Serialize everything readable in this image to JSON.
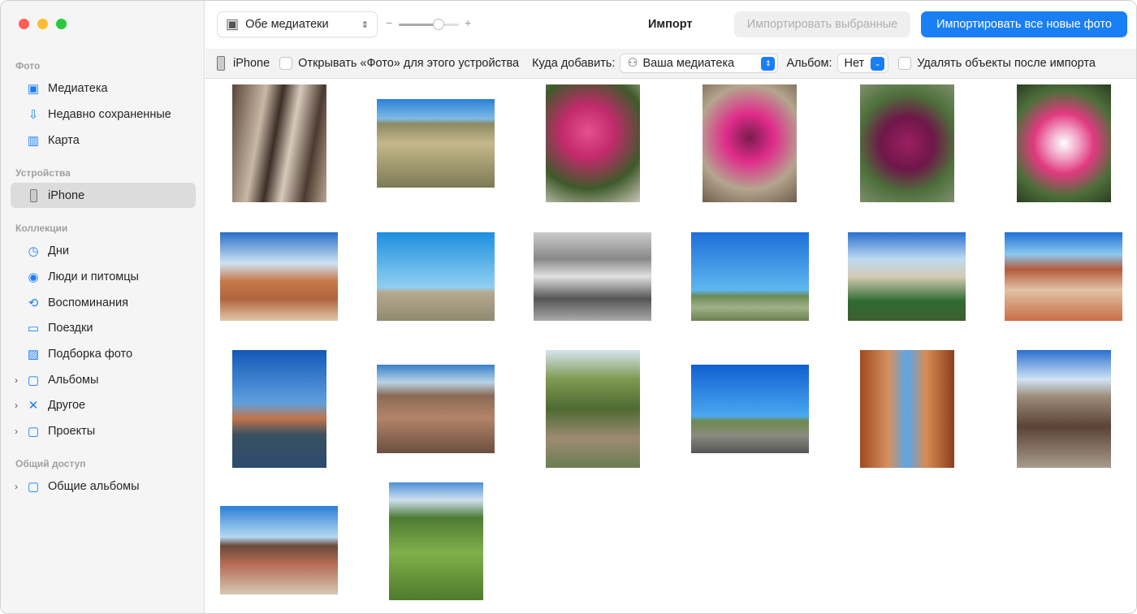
{
  "sidebar": {
    "sections": [
      {
        "title": "Фото"
      },
      {
        "title": "Устройства"
      },
      {
        "title": "Коллекции"
      },
      {
        "title": "Общий доступ"
      }
    ],
    "items": [
      {
        "label": "Медиатека",
        "icon": "photo-library-icon"
      },
      {
        "label": "Недавно сохраненные",
        "icon": "download-tray-icon"
      },
      {
        "label": "Карта",
        "icon": "map-icon"
      },
      {
        "label": "iPhone",
        "icon": "iphone-icon",
        "selected": true
      },
      {
        "label": "Дни",
        "icon": "clock-icon"
      },
      {
        "label": "Люди и питомцы",
        "icon": "person-circle-icon"
      },
      {
        "label": "Воспоминания",
        "icon": "memories-icon"
      },
      {
        "label": "Поездки",
        "icon": "suitcase-icon"
      },
      {
        "label": "Подборка фото",
        "icon": "photo-icon"
      },
      {
        "label": "Альбомы",
        "icon": "album-stack-icon"
      },
      {
        "label": "Другое",
        "icon": "tools-icon"
      },
      {
        "label": "Проекты",
        "icon": "album-stack-icon"
      },
      {
        "label": "Общие альбомы",
        "icon": "shared-album-icon"
      }
    ]
  },
  "toolbar": {
    "library_popup": "Обе медиатеки",
    "zoom_minus": "−",
    "zoom_plus": "+",
    "zoom_level": 0.7,
    "title": "Импорт",
    "import_selected": "Импортировать выбранные",
    "import_all": "Импортировать все новые фото",
    "accent": "#1a7ef5"
  },
  "import_bar": {
    "device": "iPhone",
    "open_photos_label": "Открывать «Фото» для этого устройства",
    "destination_label": "Куда добавить:",
    "destination_value": "Ваша медиатека",
    "album_label": "Альбом:",
    "album_value": "Нет",
    "delete_label": "Удалять объекты после импорта"
  },
  "photos_count": 20
}
